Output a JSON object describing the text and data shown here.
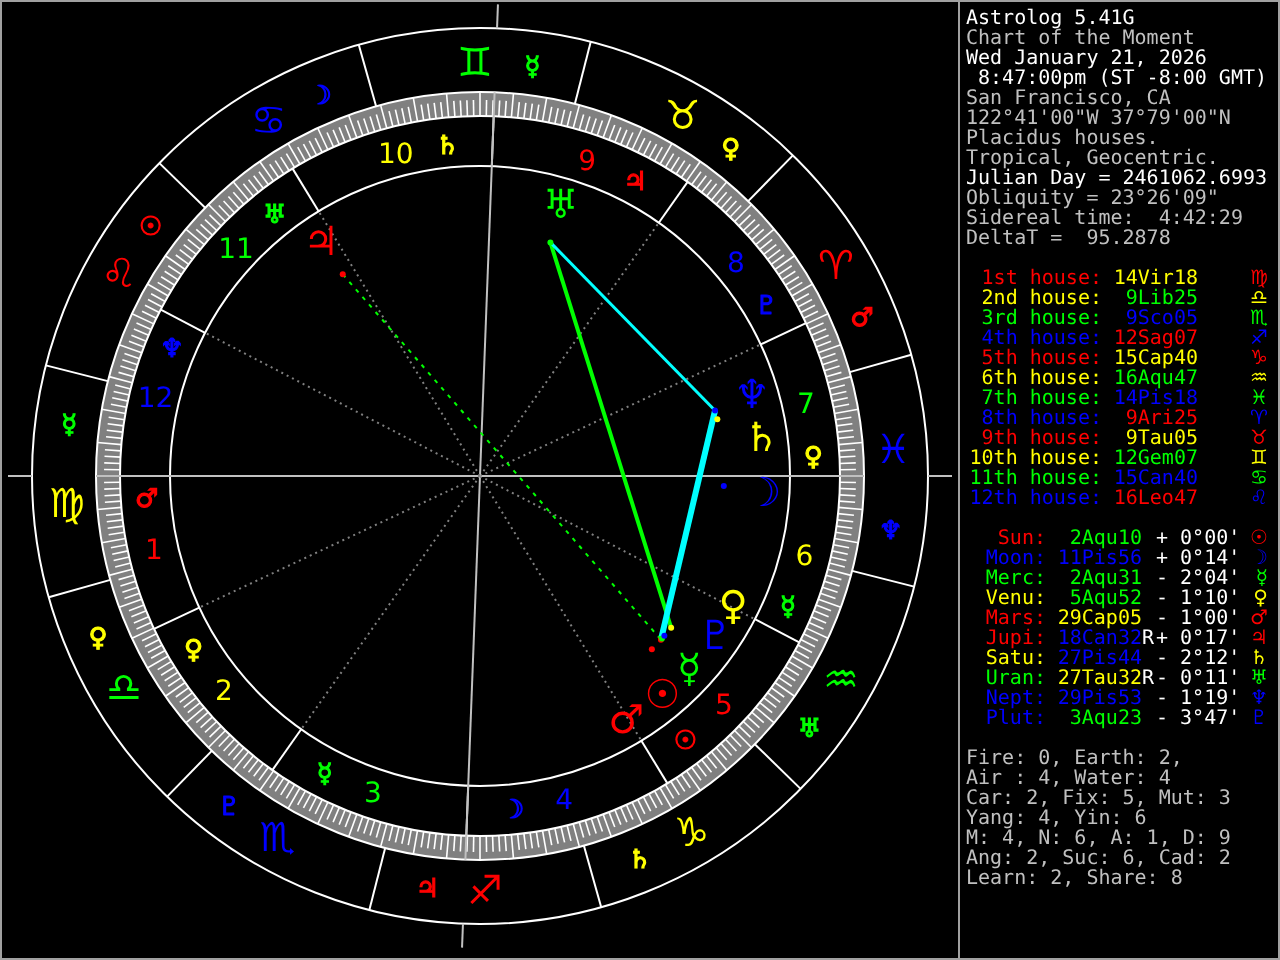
{
  "wheel": {
    "signs": [
      {
        "glyph": "♈",
        "color": "#ff0000",
        "ruler": {
          "glyph": "♂",
          "color": "#ff0000"
        }
      },
      {
        "glyph": "♉",
        "color": "#ffff00",
        "ruler": {
          "glyph": "♀",
          "color": "#ffff00"
        }
      },
      {
        "glyph": "♊",
        "color": "#00ff00",
        "ruler": {
          "glyph": "☿",
          "color": "#00ff00"
        }
      },
      {
        "glyph": "♋",
        "color": "#0000ff",
        "ruler": {
          "glyph": "☽",
          "color": "#0000ff"
        }
      },
      {
        "glyph": "♌",
        "color": "#ff0000",
        "ruler": {
          "glyph": "☉",
          "color": "#ff0000"
        }
      },
      {
        "glyph": "♍",
        "color": "#ffff00",
        "ruler": {
          "glyph": "☿",
          "color": "#00ff00"
        }
      },
      {
        "glyph": "♎",
        "color": "#00ff00",
        "ruler": {
          "glyph": "♀",
          "color": "#ffff00"
        }
      },
      {
        "glyph": "♏",
        "color": "#0000ff",
        "ruler": {
          "glyph": "♇",
          "color": "#0000ff"
        }
      },
      {
        "glyph": "♐",
        "color": "#ff0000",
        "ruler": {
          "glyph": "♃",
          "color": "#ff0000"
        }
      },
      {
        "glyph": "♑",
        "color": "#ffff00",
        "ruler": {
          "glyph": "♄",
          "color": "#ffff00"
        }
      },
      {
        "glyph": "♒",
        "color": "#00ff00",
        "ruler": {
          "glyph": "♅",
          "color": "#00ff00"
        }
      },
      {
        "glyph": "♓",
        "color": "#0000ff",
        "ruler": {
          "glyph": "♆",
          "color": "#0000ff"
        }
      }
    ],
    "houses": [
      {
        "number": "1",
        "color": "#ff0000",
        "ruler": {
          "glyph": "♂",
          "color": "#ff0000"
        }
      },
      {
        "number": "2",
        "color": "#ffff00",
        "ruler": {
          "glyph": "♀",
          "color": "#ffff00"
        }
      },
      {
        "number": "3",
        "color": "#00ff00",
        "ruler": {
          "glyph": "☿",
          "color": "#00ff00"
        }
      },
      {
        "number": "4",
        "color": "#0000ff",
        "ruler": {
          "glyph": "☽",
          "color": "#0000ff"
        }
      },
      {
        "number": "5",
        "color": "#ff0000",
        "ruler": {
          "glyph": "☉",
          "color": "#ff0000"
        }
      },
      {
        "number": "6",
        "color": "#ffff00",
        "ruler": {
          "glyph": "☿",
          "color": "#00ff00"
        }
      },
      {
        "number": "7",
        "color": "#00ff00",
        "ruler": {
          "glyph": "♀",
          "color": "#ffff00"
        }
      },
      {
        "number": "8",
        "color": "#0000ff",
        "ruler": {
          "glyph": "♇",
          "color": "#0000ff"
        }
      },
      {
        "number": "9",
        "color": "#ff0000",
        "ruler": {
          "glyph": "♃",
          "color": "#ff0000"
        }
      },
      {
        "number": "10",
        "color": "#ffff00",
        "ruler": {
          "glyph": "♄",
          "color": "#ffff00"
        }
      },
      {
        "number": "11",
        "color": "#00ff00",
        "ruler": {
          "glyph": "♅",
          "color": "#00ff00"
        }
      },
      {
        "number": "12",
        "color": "#0000ff",
        "ruler": {
          "glyph": "♆",
          "color": "#0000ff"
        }
      }
    ],
    "planets": [
      {
        "glyph": "☉",
        "color": "#ff0000"
      },
      {
        "glyph": "☽",
        "color": "#0000ff"
      },
      {
        "glyph": "☿",
        "color": "#00ff00"
      },
      {
        "glyph": "♀",
        "color": "#ffff00"
      },
      {
        "glyph": "♂",
        "color": "#ff0000"
      },
      {
        "glyph": "♃",
        "color": "#ff0000"
      },
      {
        "glyph": "♄",
        "color": "#ffff00"
      },
      {
        "glyph": "♅",
        "color": "#00ff00"
      },
      {
        "glyph": "♆",
        "color": "#0000ff"
      },
      {
        "glyph": "♇",
        "color": "#0000ff"
      }
    ]
  },
  "info": [
    {
      "text": "Astrolog 5.41G",
      "emphasis": true
    },
    {
      "text": "Chart of the Moment",
      "emphasis": false
    },
    {
      "text": "Wed January 21, 2026",
      "emphasis": true
    },
    {
      "text": " 8:47:00pm (ST -8:00 GMT)",
      "emphasis": true
    },
    {
      "text": "San Francisco, CA",
      "emphasis": false
    },
    {
      "text": "122°41'00\"W 37°79'00\"N",
      "emphasis": false
    },
    {
      "text": "Placidus houses.",
      "emphasis": false
    },
    {
      "text": "Tropical, Geocentric.",
      "emphasis": false
    },
    {
      "text": "Julian Day = 2461062.6993",
      "emphasis": true
    },
    {
      "text": "Obliquity = 23°26'09\"",
      "emphasis": false
    },
    {
      "text": "Sidereal time:  4:42:29",
      "emphasis": false
    },
    {
      "text": "DeltaT =  95.2878",
      "emphasis": false
    }
  ],
  "houses": [
    {
      "label": "1st house:",
      "color": "#ff0000",
      "position": {
        "text": "14Vir18",
        "color": "#ffff00"
      },
      "glyph": "♍"
    },
    {
      "label": "2nd house:",
      "color": "#ffff00",
      "position": {
        "text": "9Lib25",
        "color": "#00ff00"
      },
      "glyph": "♎"
    },
    {
      "label": "3rd house:",
      "color": "#00ff00",
      "position": {
        "text": "9Sco05",
        "color": "#0000ff"
      },
      "glyph": "♏"
    },
    {
      "label": "4th house:",
      "color": "#0000ff",
      "position": {
        "text": "12Sag07",
        "color": "#ff0000"
      },
      "glyph": "♐"
    },
    {
      "label": "5th house:",
      "color": "#ff0000",
      "position": {
        "text": "15Cap40",
        "color": "#ffff00"
      },
      "glyph": "♑"
    },
    {
      "label": "6th house:",
      "color": "#ffff00",
      "position": {
        "text": "16Aqu47",
        "color": "#00ff00"
      },
      "glyph": "♒"
    },
    {
      "label": "7th house:",
      "color": "#00ff00",
      "position": {
        "text": "14Pis18",
        "color": "#0000ff"
      },
      "glyph": "♓"
    },
    {
      "label": "8th house:",
      "color": "#0000ff",
      "position": {
        "text": "9Ari25",
        "color": "#ff0000"
      },
      "glyph": "♈"
    },
    {
      "label": "9th house:",
      "color": "#ff0000",
      "position": {
        "text": "9Tau05",
        "color": "#ffff00"
      },
      "glyph": "♉"
    },
    {
      "label": "10th house:",
      "color": "#ffff00",
      "position": {
        "text": "12Gem07",
        "color": "#00ff00"
      },
      "glyph": "♊"
    },
    {
      "label": "11th house:",
      "color": "#00ff00",
      "position": {
        "text": "15Can40",
        "color": "#0000ff"
      },
      "glyph": "♋"
    },
    {
      "label": "12th house:",
      "color": "#0000ff",
      "position": {
        "text": "16Leo47",
        "color": "#ff0000"
      },
      "glyph": "♌"
    }
  ],
  "planets": [
    {
      "name": "Sun:",
      "color": "#ff0000",
      "position": {
        "text": "2Aqu10",
        "color": "#00ff00"
      },
      "motion": "+ 0°00'",
      "glyph": "☉"
    },
    {
      "name": "Moon:",
      "color": "#0000ff",
      "position": {
        "text": "11Pis56",
        "color": "#0000ff"
      },
      "motion": "+ 0°14'",
      "glyph": "☽"
    },
    {
      "name": "Merc:",
      "color": "#00ff00",
      "position": {
        "text": "2Aqu31",
        "color": "#00ff00"
      },
      "motion": "- 2°04'",
      "glyph": "☿"
    },
    {
      "name": "Venu:",
      "color": "#ffff00",
      "position": {
        "text": "5Aqu52",
        "color": "#00ff00"
      },
      "motion": "- 1°10'",
      "glyph": "♀"
    },
    {
      "name": "Mars:",
      "color": "#ff0000",
      "position": {
        "text": "29Cap05",
        "color": "#ffff00"
      },
      "motion": "- 1°00'",
      "glyph": "♂"
    },
    {
      "name": "Jupi:",
      "color": "#ff0000",
      "position": {
        "text": "18Can32",
        "color": "#0000ff"
      },
      "retrograde": "R",
      "motion": "+ 0°17'",
      "glyph": "♃"
    },
    {
      "name": "Satu:",
      "color": "#ffff00",
      "position": {
        "text": "27Pis44",
        "color": "#0000ff"
      },
      "motion": "- 2°12'",
      "glyph": "♄"
    },
    {
      "name": "Uran:",
      "color": "#00ff00",
      "position": {
        "text": "27Tau32",
        "color": "#ffff00"
      },
      "retrograde": "R",
      "motion": "- 0°11'",
      "glyph": "♅"
    },
    {
      "name": "Nept:",
      "color": "#0000ff",
      "position": {
        "text": "29Pis53",
        "color": "#0000ff"
      },
      "motion": "- 1°19'",
      "glyph": "♆"
    },
    {
      "name": "Plut:",
      "color": "#0000ff",
      "position": {
        "text": "3Aqu23",
        "color": "#00ff00"
      },
      "motion": "- 3°47'",
      "glyph": "♇"
    }
  ],
  "summary": [
    "Fire: 0, Earth: 2,",
    "Air : 4, Water: 4",
    "Car: 2, Fix: 5, Mut: 3",
    "Yang: 4, Yin: 6",
    "M: 4, N: 6, A: 1, D: 9",
    "Ang: 2, Suc: 6, Cad: 2",
    "Learn: 2, Share: 8"
  ]
}
